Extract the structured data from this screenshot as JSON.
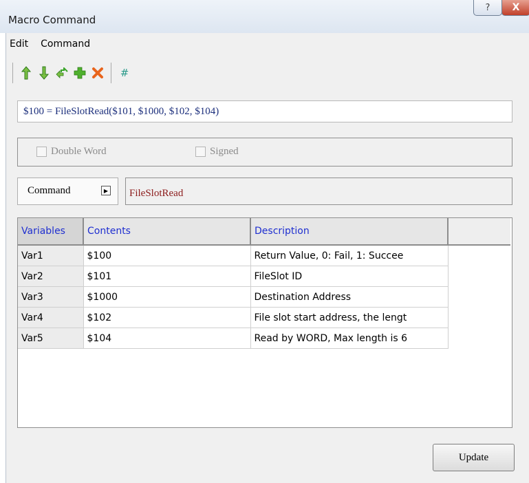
{
  "window": {
    "title": "Macro Command",
    "help_glyph": "?",
    "close_glyph": "X"
  },
  "menu": [
    "Edit",
    "Command"
  ],
  "toolbar": {
    "icons": [
      "arrow-up-icon",
      "arrow-down-icon",
      "swap-icon",
      "add-icon",
      "delete-icon",
      "hash-icon"
    ],
    "hash_label": "#",
    "colors": {
      "green": "#3aa52a",
      "orange": "#e8641c",
      "teal": "#2a9a8a"
    }
  },
  "formula": "$100 = FileSlotRead($101, $1000, $102, $104)",
  "options": {
    "double_word": "Double Word",
    "signed": "Signed"
  },
  "command": {
    "button_label": "Command",
    "value": "FileSlotRead"
  },
  "table": {
    "headers": [
      "Variables",
      "Contents",
      "Description"
    ],
    "rows": [
      {
        "var": "Var1",
        "content": "$100",
        "desc": "Return Value, 0: Fail, 1: Succee"
      },
      {
        "var": "Var2",
        "content": "$101",
        "desc": "FileSlot ID"
      },
      {
        "var": "Var3",
        "content": "$1000",
        "desc": "Destination Address"
      },
      {
        "var": "Var4",
        "content": "$102",
        "desc": "File slot start address, the lengt"
      },
      {
        "var": "Var5",
        "content": "$104",
        "desc": "Read by WORD, Max length is 6"
      }
    ]
  },
  "update_label": "Update"
}
